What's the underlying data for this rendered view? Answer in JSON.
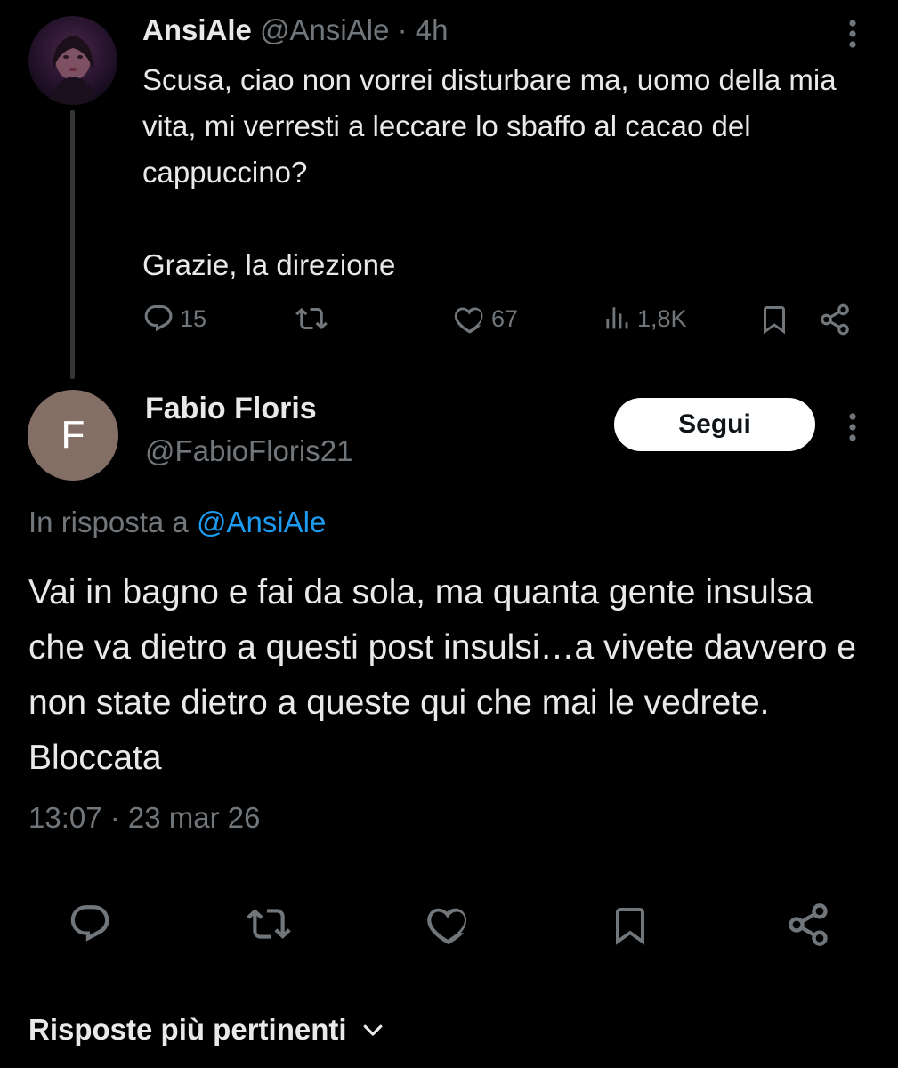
{
  "parent_tweet": {
    "name": "AnsiAle",
    "handle": "@AnsiAle",
    "time": "· 4h",
    "text": "Scusa, ciao non vorrei disturbare ma, uomo della mia vita, mi verresti a leccare lo sbaffo al cacao del cappuccino?\n\nGrazie, la direzione",
    "actions": {
      "replies": "15",
      "likes": "67",
      "views": "1,8K"
    }
  },
  "main_tweet": {
    "avatar_letter": "F",
    "name": "Fabio Floris",
    "handle": "@FabioFloris21",
    "follow_label": "Segui",
    "reply_prefix": "In risposta a",
    "reply_mention": "@AnsiAle",
    "text": "Vai in bagno e fai da sola, ma quanta gente insulsa che va dietro a questi post insulsi…a vivete davvero e non state dietro a queste qui che mai le vedrete. Bloccata",
    "timestamp": "13:07 · 23 mar 26"
  },
  "sort": {
    "label": "Risposte più pertinenti"
  },
  "icons": {
    "reply": "reply-icon",
    "retweet": "retweet-icon",
    "like": "heart-icon",
    "views": "views-icon",
    "bookmark": "bookmark-icon",
    "share": "share-icon",
    "more": "more-vertical-icon",
    "chevron": "chevron-down-icon"
  },
  "colors": {
    "background": "#000000",
    "text": "#e7e9ea",
    "muted": "#71767b",
    "link": "#1d9bf0",
    "avatar_bg": "#836f66"
  }
}
